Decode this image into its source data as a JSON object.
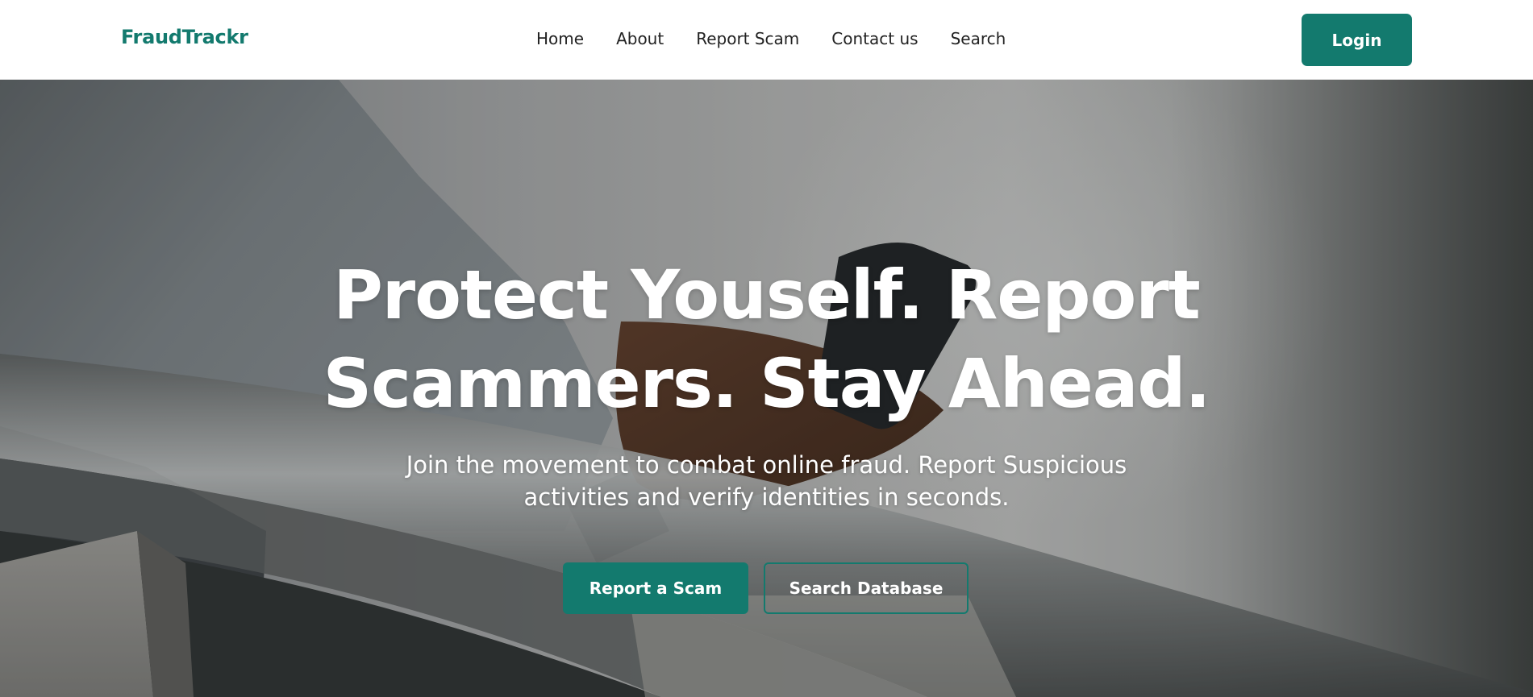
{
  "colors": {
    "brand": "#137a6e",
    "nav_text": "#222222",
    "hero_text": "#ffffff"
  },
  "navbar": {
    "brand": "FraudTrackr",
    "links": [
      {
        "label": "Home"
      },
      {
        "label": "About"
      },
      {
        "label": "Report Scam"
      },
      {
        "label": "Contact us"
      },
      {
        "label": "Search"
      }
    ],
    "login_label": "Login"
  },
  "hero": {
    "background_image": "person-in-suit-holding-phone-photo",
    "title_lines": [
      "Protect Youself. Report",
      "Scammers. Stay Ahead."
    ],
    "subtitle_lines": [
      "Join the movement to combat online fraud. Report Suspicious",
      "activities and verify identities in seconds."
    ],
    "primary_cta": "Report a Scam",
    "secondary_cta": "Search Database"
  }
}
